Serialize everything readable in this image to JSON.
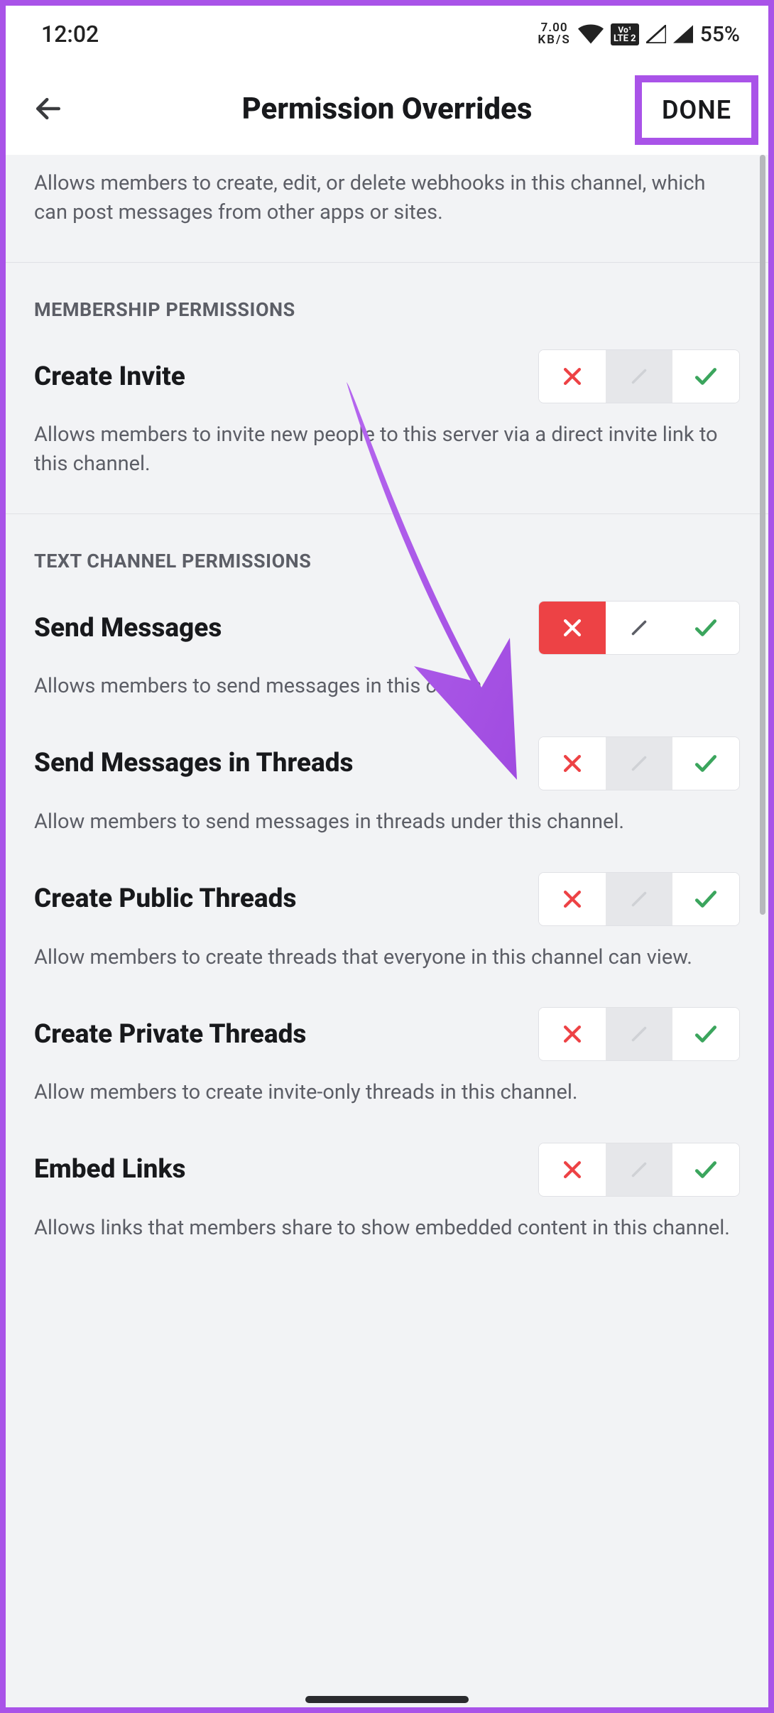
{
  "statusBar": {
    "time": "12:02",
    "kbsTop": "7.00",
    "kbsBottom": "KB/S",
    "lteTop": "Vo¹",
    "lteBottom": "LTE 2",
    "battery": "55%"
  },
  "header": {
    "title": "Permission Overrides",
    "done": "DONE"
  },
  "intro": "Allows members to create, edit, or delete webhooks in this channel, which can post messages from other apps or sites.",
  "sections": {
    "membership": "MEMBERSHIP PERMISSIONS",
    "textChannel": "TEXT CHANNEL PERMISSIONS"
  },
  "perms": {
    "createInvite": {
      "title": "Create Invite",
      "desc": "Allows members to invite new people to this server via a direct invite link to this channel.",
      "state": "neutral"
    },
    "sendMessages": {
      "title": "Send Messages",
      "desc": "Allows members to send messages in this channel.",
      "state": "deny"
    },
    "sendMessagesThreads": {
      "title": "Send Messages in Threads",
      "desc": "Allow members to send messages in threads under this channel.",
      "state": "neutral"
    },
    "createPublicThreads": {
      "title": "Create Public Threads",
      "desc": "Allow members to create threads that everyone in this channel can view.",
      "state": "neutral"
    },
    "createPrivateThreads": {
      "title": "Create Private Threads",
      "desc": "Allow members to create invite-only threads in this channel.",
      "state": "neutral"
    },
    "embedLinks": {
      "title": "Embed Links",
      "desc": "Allows links that members share to show embedded content in this channel.",
      "state": "neutral"
    }
  }
}
